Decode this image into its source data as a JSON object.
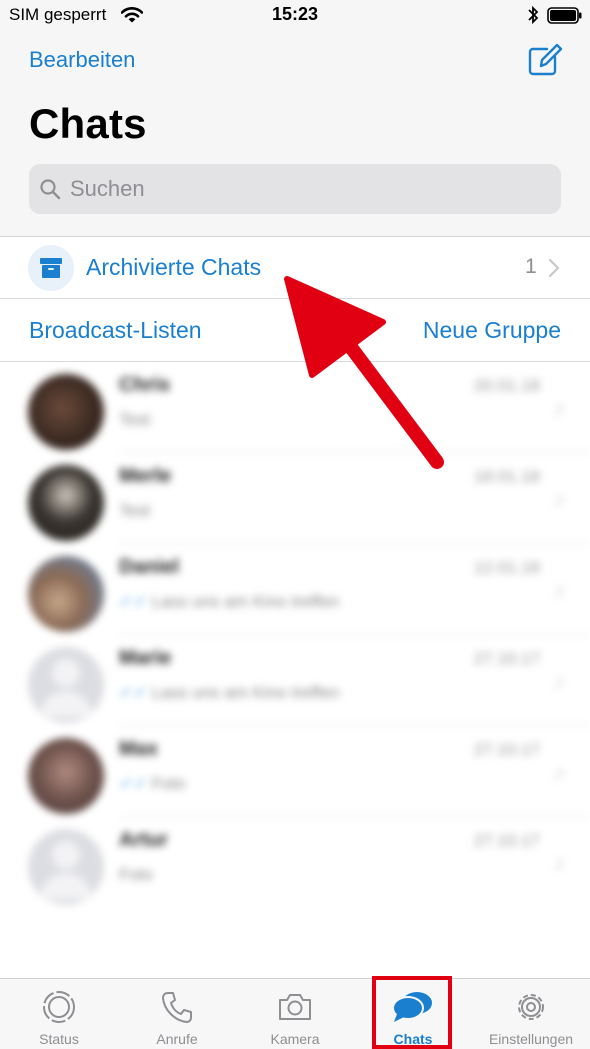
{
  "status_bar": {
    "carrier": "SIM gesperrt",
    "time": "15:23"
  },
  "header": {
    "edit_label": "Bearbeiten",
    "title": "Chats"
  },
  "search": {
    "placeholder": "Suchen"
  },
  "archived": {
    "label": "Archivierte Chats",
    "count": "1"
  },
  "lists": {
    "broadcast": "Broadcast-Listen",
    "new_group": "Neue Gruppe"
  },
  "chats": [
    {
      "name": "Chris",
      "time": "20.01.18",
      "preview": "Test"
    },
    {
      "name": "Merle",
      "time": "18.01.18",
      "preview": "Test"
    },
    {
      "name": "Daniel",
      "time": "12.01.18",
      "preview": "Lass uns am Kino treffen"
    },
    {
      "name": "Marie",
      "time": "27.10.17",
      "preview": "Lass uns am Kino treffen"
    },
    {
      "name": "Max",
      "time": "27.10.17",
      "preview": "Foto"
    },
    {
      "name": "Artur",
      "time": "27.10.17",
      "preview": "Foto"
    }
  ],
  "tabs": [
    {
      "label": "Status"
    },
    {
      "label": "Anrufe"
    },
    {
      "label": "Kamera"
    },
    {
      "label": "Chats"
    },
    {
      "label": "Einstellungen"
    }
  ],
  "colors": {
    "accent": "#1a7fcf",
    "annotation": "#e10012"
  }
}
